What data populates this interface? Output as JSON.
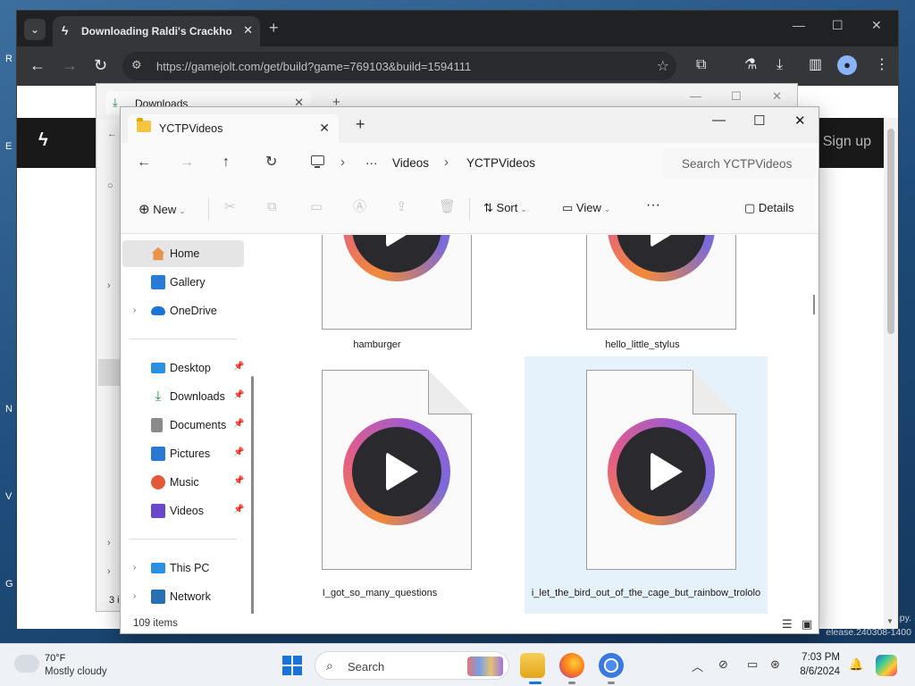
{
  "chrome": {
    "tab_title": "Downloading Raldi's Crackhouse",
    "url": "https://gamejolt.com/get/build?game=769103&build=1594111",
    "page_signup": "Sign up"
  },
  "bg_explorer": {
    "tab_title": "Downloads",
    "count_partial": "3 i"
  },
  "explorer": {
    "tab_title": "YCTPVideos",
    "breadcrumb": [
      "Videos",
      "YCTPVideos"
    ],
    "search_placeholder": "Search YCTPVideos",
    "toolbar": {
      "new_label": "New",
      "sort_label": "Sort",
      "view_label": "View",
      "details_label": "Details"
    },
    "nav": {
      "home": "Home",
      "gallery": "Gallery",
      "onedrive": "OneDrive",
      "desktop": "Desktop",
      "downloads": "Downloads",
      "documents": "Documents",
      "pictures": "Pictures",
      "music": "Music",
      "videos": "Videos",
      "this_pc": "This PC",
      "network": "Network"
    },
    "files": [
      {
        "name": "hamburger",
        "selected": false
      },
      {
        "name": "hello_little_stylus",
        "selected": false
      },
      {
        "name": "I_got_so_many_questions",
        "selected": false
      },
      {
        "name": "i_let_the_bird_out_of_the_cage_but_rainbow_trololo",
        "selected": true
      }
    ],
    "status": {
      "item_count": "109 items"
    }
  },
  "desktop": {
    "watermark_line1": "Evaluation copy.",
    "watermark_line2": "elease.240308-1400"
  },
  "taskbar": {
    "temperature": "70°F",
    "condition": "Mostly cloudy",
    "search_label": "Search",
    "time": "7:03 PM",
    "date": "8/6/2024"
  },
  "colors": {
    "selection": "#e5f1fb",
    "chrome_frame": "#202124",
    "accent": "#1a73d6"
  }
}
